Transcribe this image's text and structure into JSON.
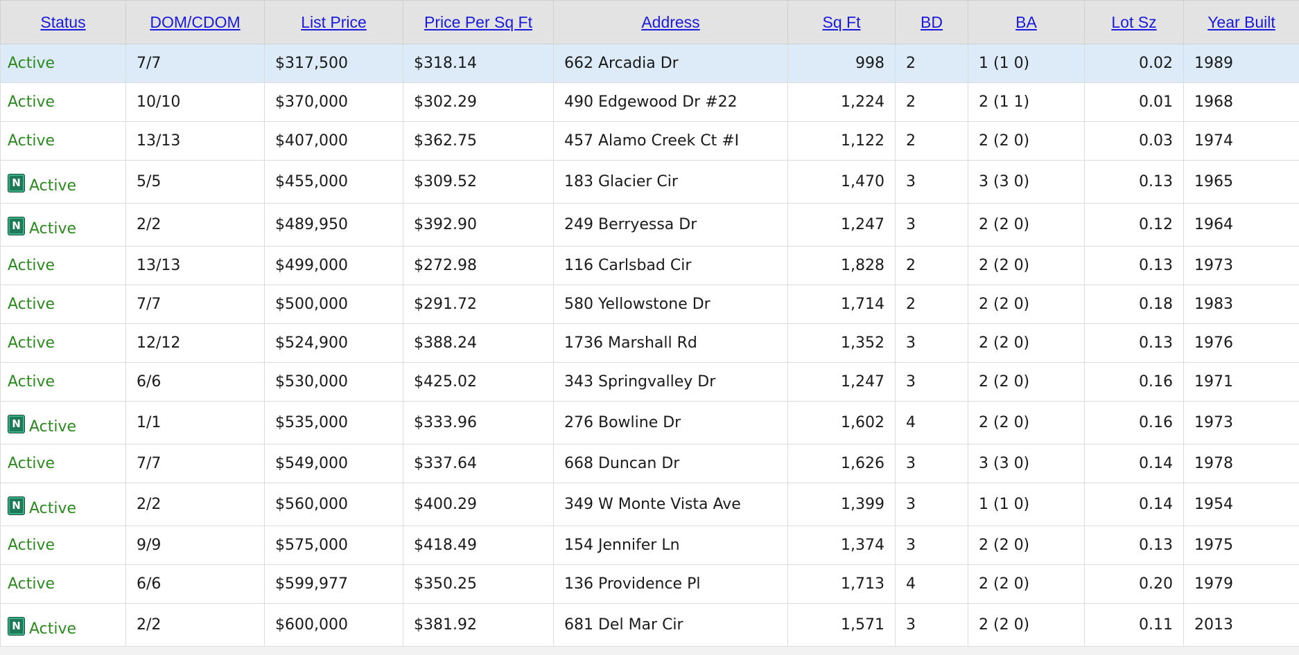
{
  "table": {
    "columns": [
      "Status",
      "DOM/CDOM",
      "List Price",
      "Price Per Sq Ft",
      "Address",
      "Sq Ft",
      "BD",
      "BA",
      "Lot Sz",
      "Year Built"
    ],
    "highlight_color": "#dcebf7",
    "status_color": "#2b8a1e",
    "link_color": "#1a1add",
    "new_badge": {
      "icon": "new-listing-badge-icon",
      "label": "N",
      "color": "#1c7a58"
    },
    "rows": [
      {
        "is_new": false,
        "status": "Active",
        "dom": "7/7",
        "price": "$317,500",
        "ppsf": "$318.14",
        "address": "662 Arcadia Dr",
        "sqft": "998",
        "bd": "2",
        "ba": "1 (1 0)",
        "lot": "0.02",
        "year": "1989"
      },
      {
        "is_new": false,
        "status": "Active",
        "dom": "10/10",
        "price": "$370,000",
        "ppsf": "$302.29",
        "address": "490 Edgewood Dr #22",
        "sqft": "1,224",
        "bd": "2",
        "ba": "2 (1 1)",
        "lot": "0.01",
        "year": "1968"
      },
      {
        "is_new": false,
        "status": "Active",
        "dom": "13/13",
        "price": "$407,000",
        "ppsf": "$362.75",
        "address": "457 Alamo Creek Ct #I",
        "sqft": "1,122",
        "bd": "2",
        "ba": "2 (2 0)",
        "lot": "0.03",
        "year": "1974"
      },
      {
        "is_new": true,
        "status": "Active",
        "dom": "5/5",
        "price": "$455,000",
        "ppsf": "$309.52",
        "address": "183 Glacier Cir",
        "sqft": "1,470",
        "bd": "3",
        "ba": "3 (3 0)",
        "lot": "0.13",
        "year": "1965"
      },
      {
        "is_new": true,
        "status": "Active",
        "dom": "2/2",
        "price": "$489,950",
        "ppsf": "$392.90",
        "address": "249 Berryessa Dr",
        "sqft": "1,247",
        "bd": "3",
        "ba": "2 (2 0)",
        "lot": "0.12",
        "year": "1964"
      },
      {
        "is_new": false,
        "status": "Active",
        "dom": "13/13",
        "price": "$499,000",
        "ppsf": "$272.98",
        "address": "116 Carlsbad Cir",
        "sqft": "1,828",
        "bd": "2",
        "ba": "2 (2 0)",
        "lot": "0.13",
        "year": "1973"
      },
      {
        "is_new": false,
        "status": "Active",
        "dom": "7/7",
        "price": "$500,000",
        "ppsf": "$291.72",
        "address": "580 Yellowstone Dr",
        "sqft": "1,714",
        "bd": "2",
        "ba": "2 (2 0)",
        "lot": "0.18",
        "year": "1983"
      },
      {
        "is_new": false,
        "status": "Active",
        "dom": "12/12",
        "price": "$524,900",
        "ppsf": "$388.24",
        "address": "1736 Marshall Rd",
        "sqft": "1,352",
        "bd": "3",
        "ba": "2 (2 0)",
        "lot": "0.13",
        "year": "1976"
      },
      {
        "is_new": false,
        "status": "Active",
        "dom": "6/6",
        "price": "$530,000",
        "ppsf": "$425.02",
        "address": "343 Springvalley Dr",
        "sqft": "1,247",
        "bd": "3",
        "ba": "2 (2 0)",
        "lot": "0.16",
        "year": "1971"
      },
      {
        "is_new": true,
        "status": "Active",
        "dom": "1/1",
        "price": "$535,000",
        "ppsf": "$333.96",
        "address": "276 Bowline Dr",
        "sqft": "1,602",
        "bd": "4",
        "ba": "2 (2 0)",
        "lot": "0.16",
        "year": "1973"
      },
      {
        "is_new": false,
        "status": "Active",
        "dom": "7/7",
        "price": "$549,000",
        "ppsf": "$337.64",
        "address": "668 Duncan Dr",
        "sqft": "1,626",
        "bd": "3",
        "ba": "3 (3 0)",
        "lot": "0.14",
        "year": "1978"
      },
      {
        "is_new": true,
        "status": "Active",
        "dom": "2/2",
        "price": "$560,000",
        "ppsf": "$400.29",
        "address": "349 W Monte Vista Ave",
        "sqft": "1,399",
        "bd": "3",
        "ba": "1 (1 0)",
        "lot": "0.14",
        "year": "1954"
      },
      {
        "is_new": false,
        "status": "Active",
        "dom": "9/9",
        "price": "$575,000",
        "ppsf": "$418.49",
        "address": "154 Jennifer Ln",
        "sqft": "1,374",
        "bd": "3",
        "ba": "2 (2 0)",
        "lot": "0.13",
        "year": "1975"
      },
      {
        "is_new": false,
        "status": "Active",
        "dom": "6/6",
        "price": "$599,977",
        "ppsf": "$350.25",
        "address": "136 Providence Pl",
        "sqft": "1,713",
        "bd": "4",
        "ba": "2 (2 0)",
        "lot": "0.20",
        "year": "1979"
      },
      {
        "is_new": true,
        "status": "Active",
        "dom": "2/2",
        "price": "$600,000",
        "ppsf": "$381.92",
        "address": "681 Del Mar Cir",
        "sqft": "1,571",
        "bd": "3",
        "ba": "2 (2 0)",
        "lot": "0.11",
        "year": "2013"
      }
    ]
  }
}
